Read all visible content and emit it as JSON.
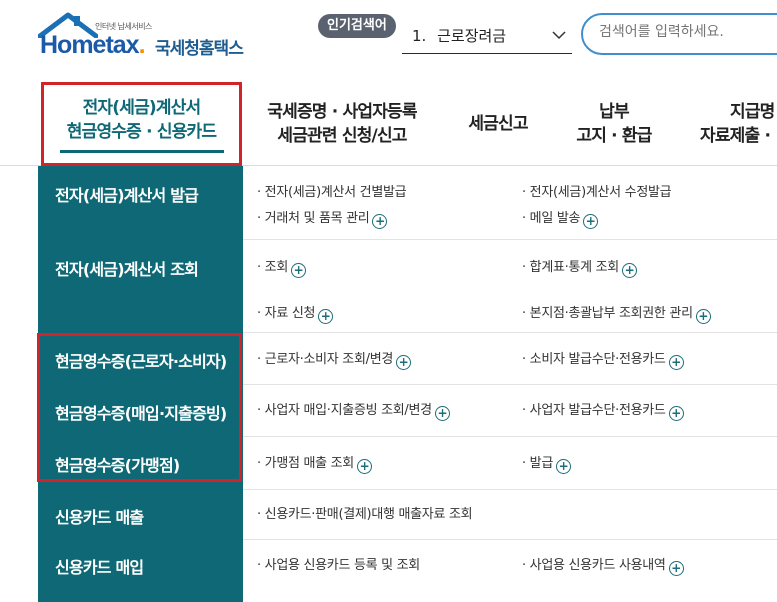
{
  "header": {
    "logo_small_text": "인터넷 납세서비스",
    "logo_main": "Hometax",
    "logo_dot": ".",
    "logo_sub": "국세청홈택스",
    "popular_label": "인기검색어",
    "popular_rank": "1.",
    "popular_keyword": "근로장려금",
    "search_placeholder": "검색어를 입력하세요."
  },
  "gnb": {
    "items": [
      {
        "line1": "전자(세금)계산서",
        "line2": "현금영수증 · 신용카드",
        "active": true
      },
      {
        "line1": "국세증명 · 사업자등록",
        "line2": "세금관련 신청/신고"
      },
      {
        "line1": "세금신고",
        "line2": ""
      },
      {
        "line1": "납부",
        "line2": "고지 · 환급"
      },
      {
        "line1": "지급명",
        "line2": "자료제출 ·"
      }
    ]
  },
  "menu": {
    "rows": [
      {
        "head": "전자(세금)계산서 발급",
        "links": [
          {
            "text": "· 전자(세금)계산서 건별발급",
            "plus": false
          },
          {
            "text": "· 전자(세금)계산서 수정발급",
            "plus": false
          },
          {
            "text": "· 거래처 및 품목 관리",
            "plus": true
          },
          {
            "text": "· 메일 발송",
            "plus": true
          }
        ]
      },
      {
        "head": "전자(세금)계산서 조회",
        "links": [
          {
            "text": "· 조회",
            "plus": true
          },
          {
            "text": "· 합계표·통계 조회",
            "plus": true
          },
          {
            "text": "· 자료 신청",
            "plus": true
          },
          {
            "text": "· 본지점·총괄납부 조회권한 관리",
            "plus": true
          }
        ]
      },
      {
        "head": "현금영수증(근로자·소비자)",
        "links": [
          {
            "text": "· 근로자·소비자 조회/변경",
            "plus": true
          },
          {
            "text": "· 소비자 발급수단·전용카드",
            "plus": true
          }
        ]
      },
      {
        "head": "현금영수증(매입·지출증빙)",
        "links": [
          {
            "text": "· 사업자 매입·지출증빙 조회/변경",
            "plus": true
          },
          {
            "text": "· 사업자 발급수단·전용카드",
            "plus": true
          }
        ]
      },
      {
        "head": "현금영수증(가맹점)",
        "links": [
          {
            "text": "· 가맹점 매출 조회",
            "plus": true
          },
          {
            "text": "· 발급",
            "plus": true
          }
        ]
      },
      {
        "head": "신용카드 매출",
        "links": [
          {
            "text": "· 신용카드·판매(결제)대행 매출자료 조회",
            "plus": false
          }
        ]
      },
      {
        "head": "신용카드 매입",
        "links": [
          {
            "text": "· 사업용 신용카드 등록 및 조회",
            "plus": false
          },
          {
            "text": "· 사업용 신용카드 사용내역",
            "plus": true
          }
        ]
      }
    ],
    "plus_symbol": "+"
  }
}
